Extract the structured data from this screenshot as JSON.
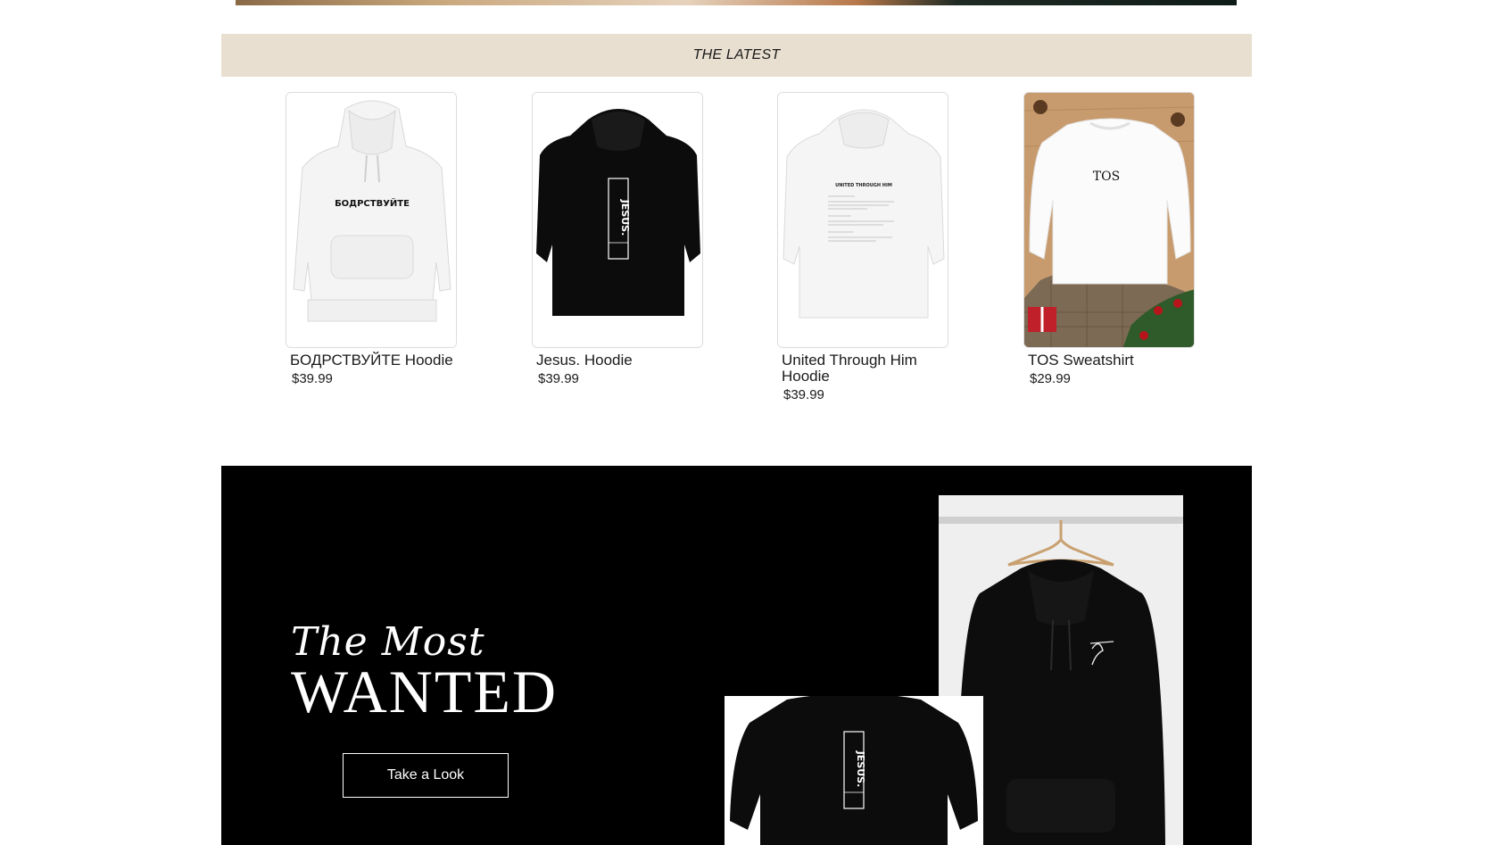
{
  "section_latest": {
    "heading": "THE LATEST"
  },
  "products": [
    {
      "name": "БОДРСТВУЙТЕ Hoodie",
      "price": "$39.99",
      "print_text": "БОДРСТВУЙТЕ",
      "color": "white"
    },
    {
      "name": "Jesus. Hoodie",
      "price": "$39.99",
      "print_text": "JESUS.",
      "color": "black"
    },
    {
      "name": "United Through Him Hoodie",
      "price": "$39.99",
      "print_text": "UNITED THROUGH HIM",
      "color": "white"
    },
    {
      "name": "TOS Sweatshirt",
      "price": "$29.99",
      "print_text": "TOS",
      "color": "white"
    }
  ],
  "most_wanted": {
    "script_text": "The Most",
    "title": "WANTED",
    "button_label": "Take a Look"
  },
  "colors": {
    "latest_strip_bg": "#e8dfd0",
    "most_wanted_bg": "#000000",
    "accent_text": "#ffffff"
  }
}
